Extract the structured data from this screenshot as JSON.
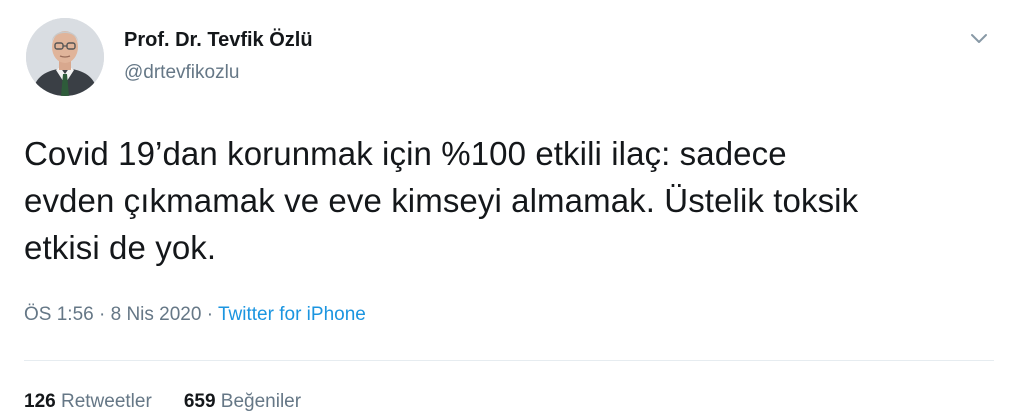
{
  "user": {
    "display_name": "Prof. Dr. Tevfik Özlü",
    "handle": "@drtevfikozlu"
  },
  "tweet": {
    "lines": [
      "Covid 19’dan korunmak için %100 etkili ilaç: sadece",
      "evden çıkmamak ve eve kimseyi almamak. Üstelik toksik",
      "etkisi de yok."
    ],
    "time": "ÖS 1:56",
    "date": "8 Nis 2020",
    "separator": "·",
    "source": "Twitter for iPhone"
  },
  "stats": {
    "retweets_count": "126",
    "retweets_label": "Retweetler",
    "likes_count": "659",
    "likes_label": "Beğeniler"
  },
  "icons": {
    "menu": "chevron-down-icon"
  },
  "colors": {
    "text": "#14171a",
    "secondary": "#657786",
    "link": "#1b95e0",
    "divider": "#e6ecf0"
  }
}
